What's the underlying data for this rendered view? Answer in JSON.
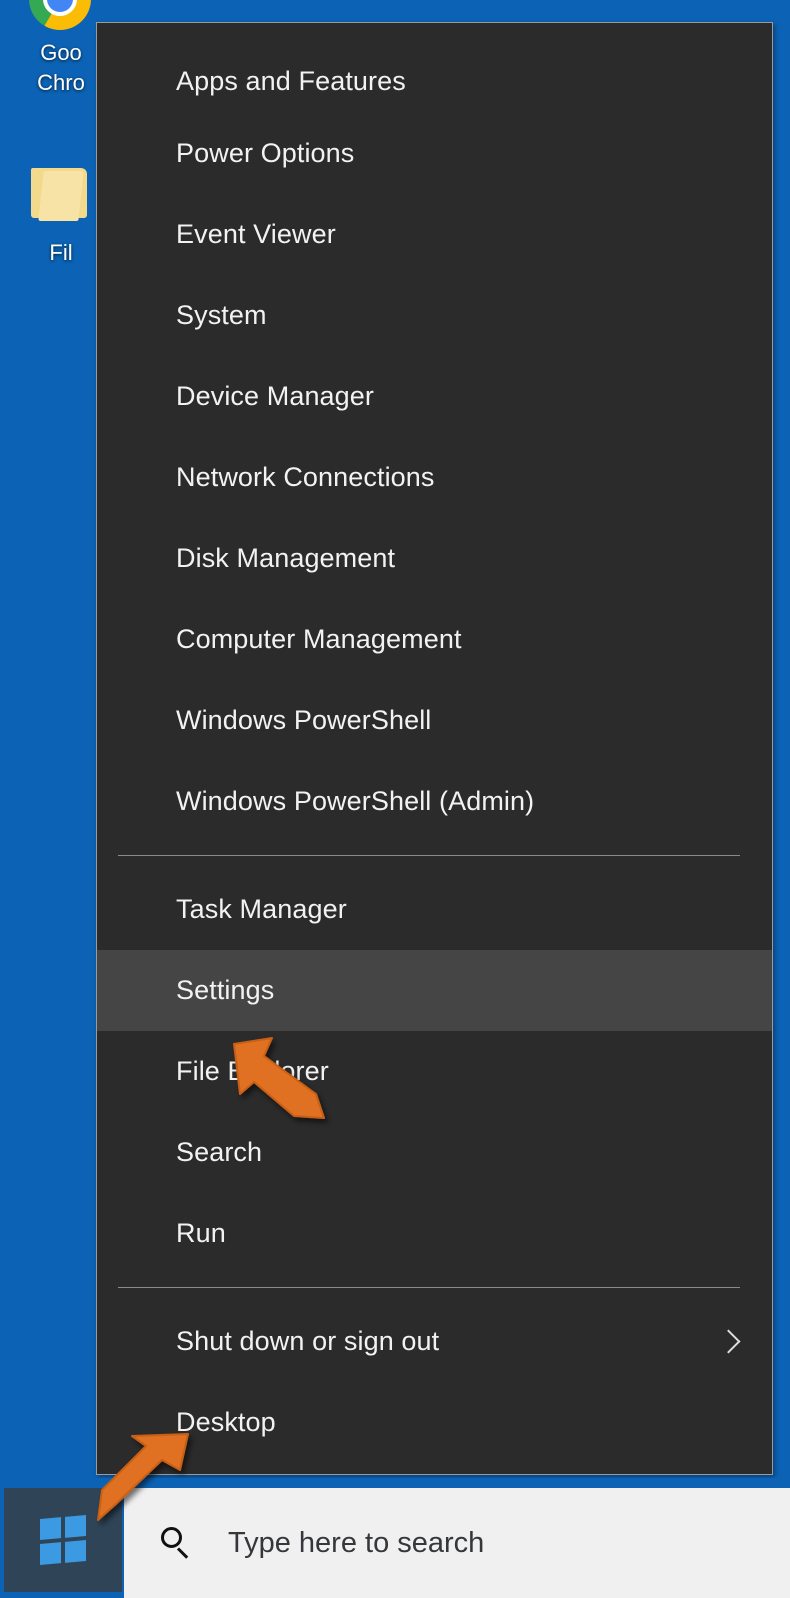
{
  "desktop": {
    "background_color": "#0c63b5",
    "icons": [
      {
        "name": "Google Chrome",
        "label_line1": "Goo",
        "label_line2": "Chro",
        "icon": "chrome-icon"
      },
      {
        "name": "File Explorer",
        "label_line1": "Fil",
        "label_line2": "",
        "icon": "folder-icon"
      }
    ]
  },
  "winx_menu": {
    "background_color": "#2b2b2b",
    "highlight_color": "#454545",
    "border_color": "#9b9b9b",
    "selected_item": "Settings",
    "groups": [
      {
        "items": [
          {
            "label": "Apps and Features",
            "selected": false,
            "submenu": false
          },
          {
            "label": "Power Options",
            "selected": false,
            "submenu": false
          },
          {
            "label": "Event Viewer",
            "selected": false,
            "submenu": false
          },
          {
            "label": "System",
            "selected": false,
            "submenu": false
          },
          {
            "label": "Device Manager",
            "selected": false,
            "submenu": false
          },
          {
            "label": "Network Connections",
            "selected": false,
            "submenu": false
          },
          {
            "label": "Disk Management",
            "selected": false,
            "submenu": false
          },
          {
            "label": "Computer Management",
            "selected": false,
            "submenu": false
          },
          {
            "label": "Windows PowerShell",
            "selected": false,
            "submenu": false
          },
          {
            "label": "Windows PowerShell (Admin)",
            "selected": false,
            "submenu": false
          }
        ]
      },
      {
        "items": [
          {
            "label": "Task Manager",
            "selected": false,
            "submenu": false
          },
          {
            "label": "Settings",
            "selected": true,
            "submenu": false
          },
          {
            "label": "File Explorer",
            "selected": false,
            "submenu": false
          },
          {
            "label": "Search",
            "selected": false,
            "submenu": false
          },
          {
            "label": "Run",
            "selected": false,
            "submenu": false
          }
        ]
      },
      {
        "items": [
          {
            "label": "Shut down or sign out",
            "selected": false,
            "submenu": true
          },
          {
            "label": "Desktop",
            "selected": false,
            "submenu": false
          }
        ]
      }
    ]
  },
  "taskbar": {
    "background_color": "#0c63b5",
    "start_button": {
      "name": "Start",
      "icon": "windows-logo-icon",
      "background_color": "#2f4456"
    },
    "search": {
      "placeholder": "Type here to search",
      "icon": "search-icon",
      "background_color": "#f0f0f0"
    }
  },
  "annotations": {
    "color": "#e07020",
    "cursors": [
      {
        "name": "settings-pointer",
        "direction": "up-left",
        "points_at": "Settings"
      },
      {
        "name": "start-button-pointer",
        "direction": "down-left",
        "points_at": "Start"
      }
    ]
  }
}
